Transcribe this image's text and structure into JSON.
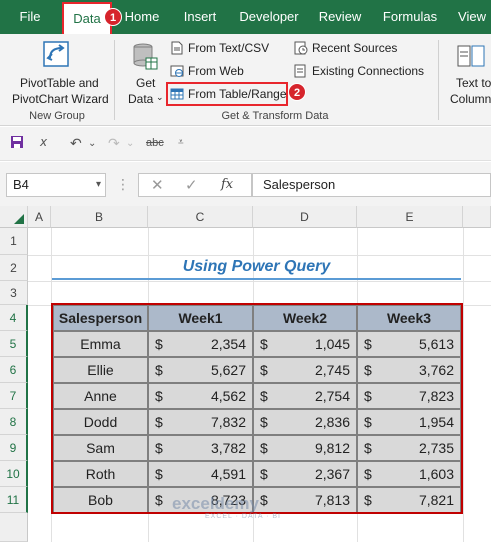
{
  "ribbon_tabs": [
    "File",
    "Data",
    "Home",
    "Insert",
    "Developer",
    "Review",
    "Formulas",
    "View"
  ],
  "step_badges": [
    "1",
    "2"
  ],
  "new_group": {
    "button_line1": "PivotTable and",
    "button_line2": "PivotChart Wizard",
    "label": "New Group"
  },
  "get_transform": {
    "get_data_line1": "Get",
    "get_data_line2": "Data",
    "from_text_csv": "From Text/CSV",
    "from_web": "From Web",
    "from_table_range": "From Table/Range",
    "recent_sources": "Recent Sources",
    "existing_connections": "Existing Connections",
    "label": "Get & Transform Data"
  },
  "text_to_columns": {
    "line1": "Text to",
    "line2": "Column"
  },
  "qat": {
    "strikethrough_label": "abc"
  },
  "formula_bar": {
    "name_box": "B4",
    "fx_label": "fx",
    "content": "Salesperson"
  },
  "grid": {
    "columns": [
      "A",
      "B",
      "C",
      "D",
      "E"
    ],
    "rows": [
      "1",
      "2",
      "3",
      "4",
      "5",
      "6",
      "7",
      "8",
      "9",
      "10",
      "11"
    ]
  },
  "sheet_title": "Using Power Query",
  "table": {
    "headers": [
      "Salesperson",
      "Week1",
      "Week2",
      "Week3"
    ],
    "currency_symbol": "$",
    "rows": [
      {
        "name": "Emma",
        "w1": "2,354",
        "w2": "1,045",
        "w3": "5,613"
      },
      {
        "name": "Ellie",
        "w1": "5,627",
        "w2": "2,745",
        "w3": "3,762"
      },
      {
        "name": "Anne",
        "w1": "4,562",
        "w2": "2,754",
        "w3": "7,823"
      },
      {
        "name": "Dodd",
        "w1": "7,832",
        "w2": "2,836",
        "w3": "1,954"
      },
      {
        "name": "Sam",
        "w1": "3,782",
        "w2": "9,812",
        "w3": "2,735"
      },
      {
        "name": "Roth",
        "w1": "4,591",
        "w2": "2,367",
        "w3": "1,603"
      },
      {
        "name": "Bob",
        "w1": "8,723",
        "w2": "7,813",
        "w3": "7,821"
      }
    ]
  },
  "watermark": {
    "main": "exceldemy",
    "sub": "EXCEL · DATA · BI"
  },
  "colors": {
    "ribbon_green": "#217346",
    "highlight_red": "#e8262d",
    "header_fill": "#acb9ca",
    "cell_fill": "#d9d9d9",
    "title_blue": "#2e75b6"
  }
}
